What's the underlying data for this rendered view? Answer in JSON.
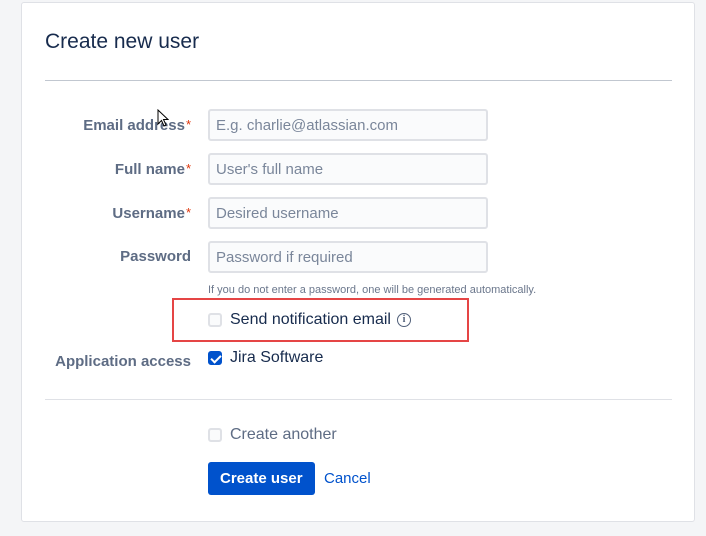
{
  "dialog": {
    "title": "Create new user"
  },
  "form": {
    "email": {
      "label": "Email address",
      "required": "*",
      "placeholder": "E.g. charlie@atlassian.com"
    },
    "fullname": {
      "label": "Full name",
      "required": "*",
      "placeholder": "User's full name"
    },
    "username": {
      "label": "Username",
      "required": "*",
      "placeholder": "Desired username"
    },
    "password": {
      "label": "Password",
      "placeholder": "Password if required",
      "hint": "If you do not enter a password, one will be generated automatically."
    },
    "send_notification": {
      "label": "Send notification email",
      "checked": false
    },
    "application_access": {
      "label": "Application access",
      "option": "Jira Software",
      "checked": true
    },
    "create_another": {
      "label": "Create another",
      "checked": false
    }
  },
  "actions": {
    "create_label": "Create user",
    "cancel_label": "Cancel"
  },
  "colors": {
    "primary": "#0052cc",
    "required": "#de350b",
    "highlight": "#e54545"
  },
  "icons": {
    "info": "info-icon",
    "cursor": "mouse-pointer-icon"
  }
}
